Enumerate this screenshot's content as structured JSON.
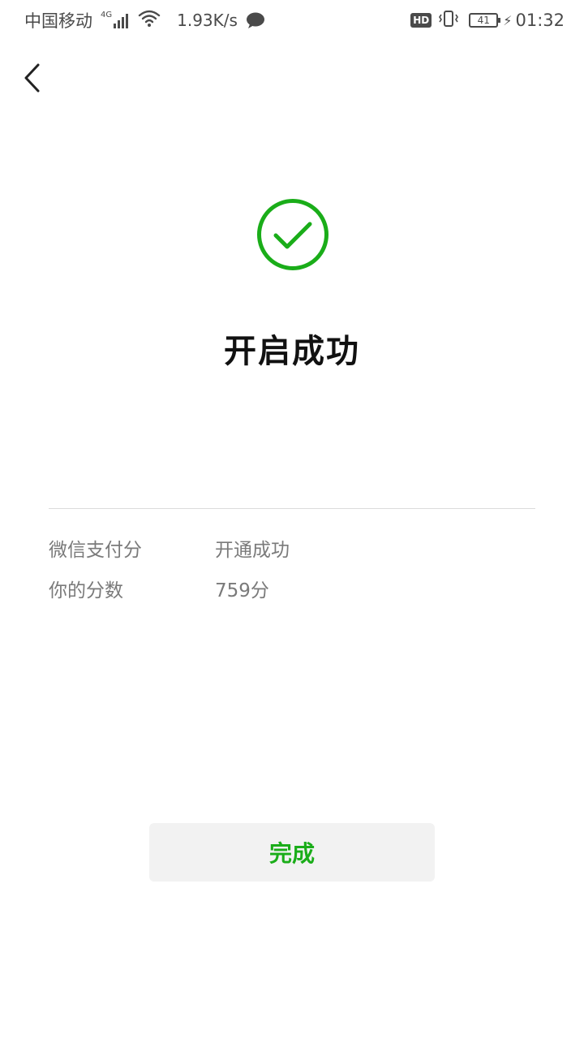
{
  "status_bar": {
    "carrier": "中国移动",
    "network_gen": "4G",
    "net_speed": "1.93K/s",
    "hd": "HD",
    "battery": "41",
    "time": "01:32"
  },
  "nav": {
    "back_icon": "chevron-left-icon"
  },
  "success": {
    "icon": "check-circle-icon",
    "icon_color": "#1aad19",
    "title": "开启成功"
  },
  "details": [
    {
      "label": "微信支付分",
      "value": "开通成功"
    },
    {
      "label": "你的分数",
      "value": "759分"
    }
  ],
  "actions": {
    "done_label": "完成",
    "done_color": "#1aad19"
  }
}
